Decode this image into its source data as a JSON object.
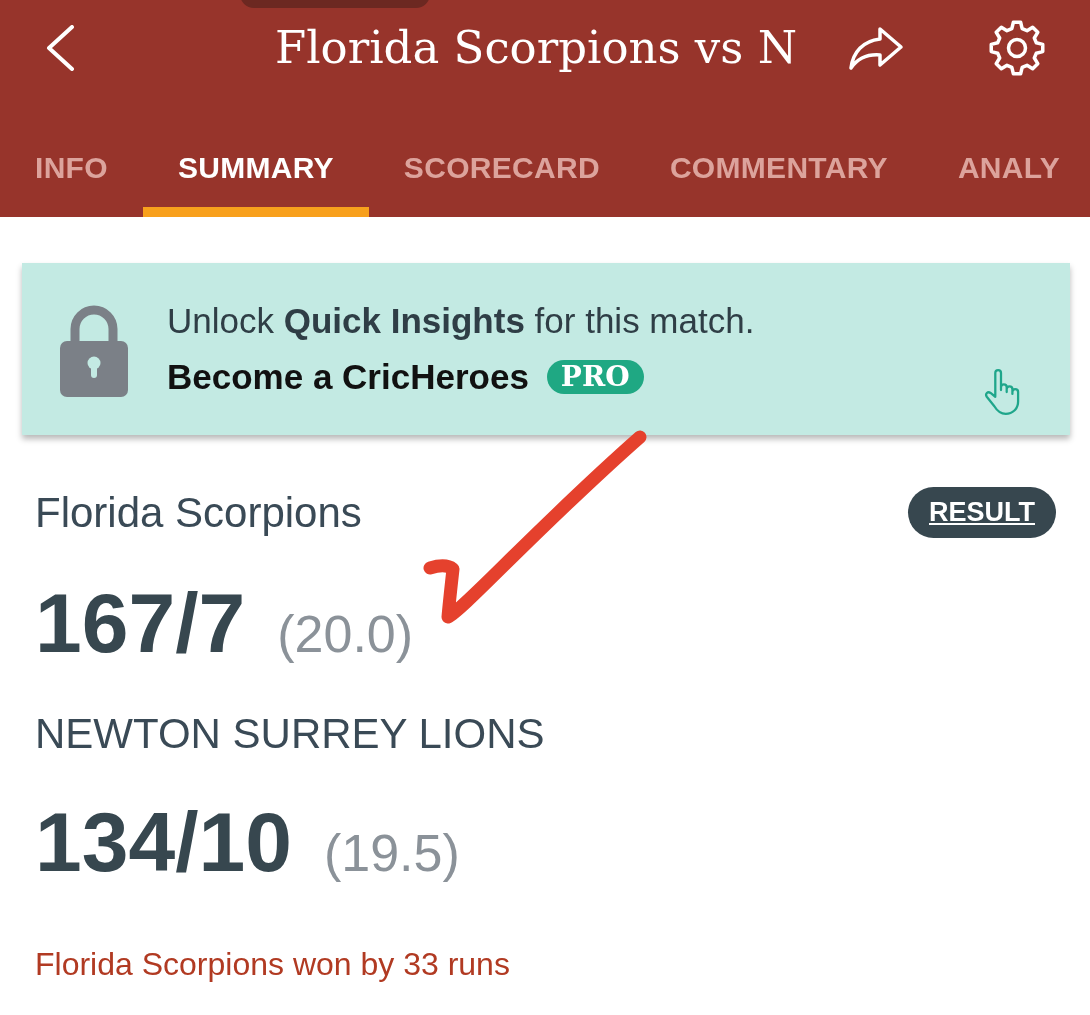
{
  "app_bar": {
    "title": "Florida Scorpions vs N"
  },
  "tabs": [
    {
      "label": "INFO",
      "selected": false
    },
    {
      "label": "SUMMARY",
      "selected": true
    },
    {
      "label": "SCORECARD",
      "selected": false
    },
    {
      "label": "COMMENTARY",
      "selected": false
    },
    {
      "label": "ANALY",
      "selected": false
    }
  ],
  "promo_banner": {
    "line_1": "Unlock **Quick Insights** for this match.",
    "line_2": "Become a CricHeroes",
    "badge": "PRO"
  },
  "match": {
    "status_badge": "RESULT",
    "innings": [
      {
        "team": "Florida Scorpions",
        "score": "167/7",
        "overs": "(20.0)"
      },
      {
        "team": "NEWTON SURREY LIONS",
        "score": "134/10",
        "overs": "(19.5)"
      }
    ],
    "result": "Florida Scorpions won by 33 runs"
  }
}
